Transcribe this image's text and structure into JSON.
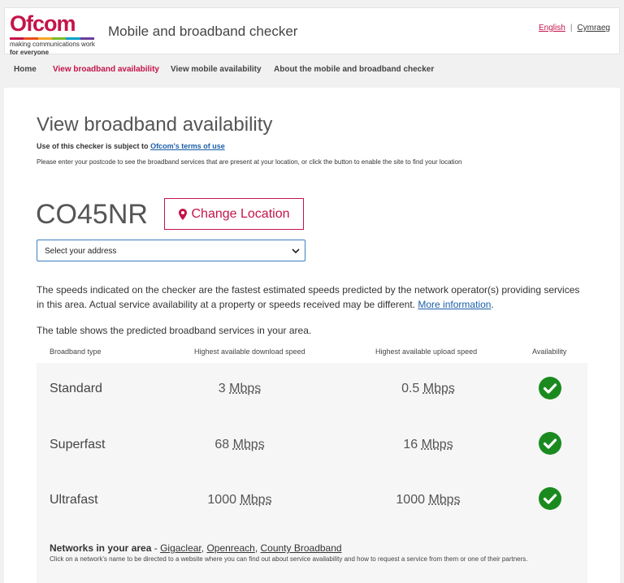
{
  "header": {
    "logo_word": "Ofcom",
    "logo_tag1": "making communications work",
    "logo_tag2": "for everyone",
    "title": "Mobile and broadband checker",
    "lang_en": "English",
    "lang_sep": "|",
    "lang_cy": "Cymraeg"
  },
  "nav": {
    "items": [
      {
        "label": "Home"
      },
      {
        "label": "View broadband availability"
      },
      {
        "label": "View mobile availability"
      },
      {
        "label": "About the mobile and broadband checker"
      }
    ]
  },
  "page": {
    "title": "View broadband availability",
    "terms_prefix": "Use of this checker is subject to",
    "terms_link": "Ofcom's terms of use",
    "instructions": "Please enter your postcode to see the broadband services that are present at your location, or click the button to enable the site to find your location",
    "postcode": "CO45NR",
    "change_location": "Change Location",
    "address_select": "Select your address",
    "speeds_text": "The speeds indicated on the checker are the fastest estimated speeds predicted by the network operator(s) providing services in this area. Actual service availability at a property or speeds received may be different.",
    "more_info": "More information",
    "period": ".",
    "table_intro": "The table shows the predicted broadband services in your area."
  },
  "table": {
    "headers": [
      "Broadband type",
      "Highest available download speed",
      "Highest available upload speed",
      "Availability"
    ],
    "rows": [
      {
        "type": "Standard",
        "download": "3",
        "download_unit": "Mbps",
        "upload": "0.5",
        "upload_unit": "Mbps",
        "available": true
      },
      {
        "type": "Superfast",
        "download": "68",
        "download_unit": "Mbps",
        "upload": "16",
        "upload_unit": "Mbps",
        "available": true
      },
      {
        "type": "Ultrafast",
        "download": "1000",
        "download_unit": "Mbps",
        "upload": "1000",
        "upload_unit": "Mbps",
        "available": true
      }
    ]
  },
  "networks": {
    "label": "Networks in your area",
    "dash": " - ",
    "list": [
      "Gigaclear",
      "Openreach",
      "County Broadband"
    ],
    "note": "Click on a network's name to be directed to a website where you can find out about service availability and how to request a service from them or one of their partners."
  },
  "colors": {
    "brand": "#c4144a",
    "link": "#1a5ea8",
    "check": "#1a8a1f"
  }
}
